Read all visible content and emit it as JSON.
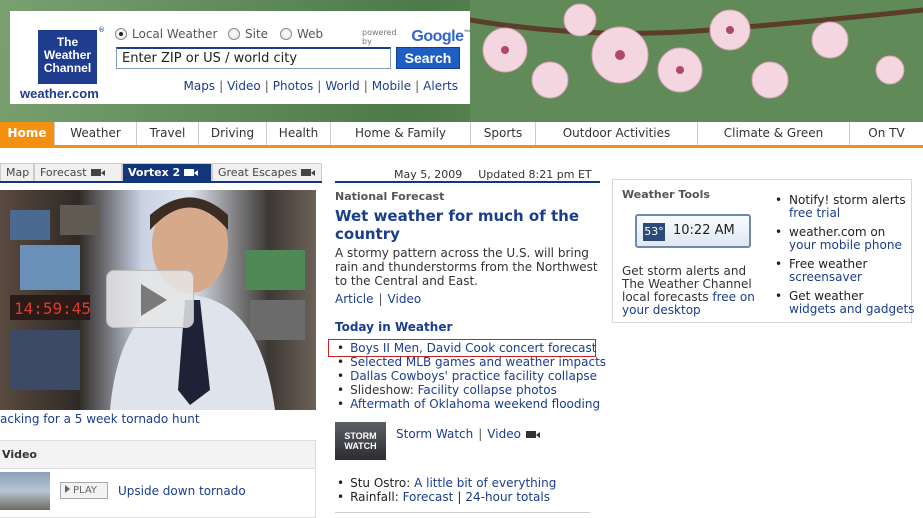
{
  "header": {
    "logo_lines": [
      "The",
      "Weather",
      "Channel"
    ],
    "logo_tm": "®",
    "logo_domain": "weather.com",
    "search_scopes": [
      {
        "label": "Local Weather",
        "selected": true
      },
      {
        "label": "Site",
        "selected": false
      },
      {
        "label": "Web",
        "selected": false
      }
    ],
    "powered_by": "powered by",
    "google": "Google",
    "google_tm": "™",
    "search_value": "Enter ZIP or US / world city",
    "search_button": "Search",
    "quick_links": [
      "Maps",
      "Video",
      "Photos",
      "World",
      "Mobile",
      "Alerts"
    ]
  },
  "nav": {
    "items": [
      "Home",
      "Weather",
      "Travel",
      "Driving",
      "Health",
      "Home & Family",
      "Sports",
      "Outdoor Activities",
      "Climate & Green",
      "On TV"
    ],
    "active": "Home",
    "accent_color": "#f39010"
  },
  "video": {
    "tabs": [
      {
        "label": "Map",
        "camera": false,
        "active": false
      },
      {
        "label": "Forecast",
        "camera": true,
        "active": false
      },
      {
        "label": "Vortex 2",
        "camera": true,
        "active": true
      },
      {
        "label": "Great Escapes",
        "camera": true,
        "active": false
      }
    ],
    "caption": "acking for a 5 week tornado hunt",
    "box_title": "Video",
    "play_label": "PLAY",
    "item_link": "Upside down tornado"
  },
  "center": {
    "date": "May 5, 2009",
    "updated": "Updated 8:21 pm ET",
    "section_label": "National Forecast",
    "headline": "Wet weather for much of the country",
    "summary": "A stormy pattern across the U.S. will bring rain and thunderstorms from the Northwest to the Central and East.",
    "article_links": [
      "Article",
      "Video"
    ],
    "today_title": "Today in Weather",
    "today_items": [
      {
        "prefix": "",
        "link": "Boys II Men, David Cook concert forecast"
      },
      {
        "prefix": "",
        "link": "Selected MLB games and weather impacts"
      },
      {
        "prefix": "",
        "link": "Dallas Cowboys' practice facility collapse"
      },
      {
        "prefix": "Slideshow: ",
        "link": "Facility collapse photos"
      },
      {
        "prefix": "",
        "link": "Aftermath of Oklahoma weekend flooding"
      }
    ],
    "storm_watch_thumb": [
      "STORM",
      "WATCH"
    ],
    "storm_watch_links": [
      "Storm Watch",
      "Video"
    ],
    "bottom_items": [
      {
        "prefix": "Stu Ostro: ",
        "links": [
          "A little bit of everything"
        ]
      },
      {
        "prefix": "Rainfall: ",
        "links": [
          "Forecast",
          "24-hour totals"
        ]
      }
    ]
  },
  "tools": {
    "title": "Weather Tools",
    "temp": "53°",
    "time": "10:22 AM",
    "desc_text": "Get storm alerts and The Weather Channel local forecasts",
    "desc_link": "free on your desktop",
    "items": [
      {
        "text": "Notify! storm alerts",
        "link": "free trial"
      },
      {
        "text": "weather.com on",
        "link": "your mobile phone"
      },
      {
        "text": "Free weather",
        "link": "screensaver"
      },
      {
        "text": "Get weather",
        "link": "widgets and gadgets"
      }
    ]
  }
}
